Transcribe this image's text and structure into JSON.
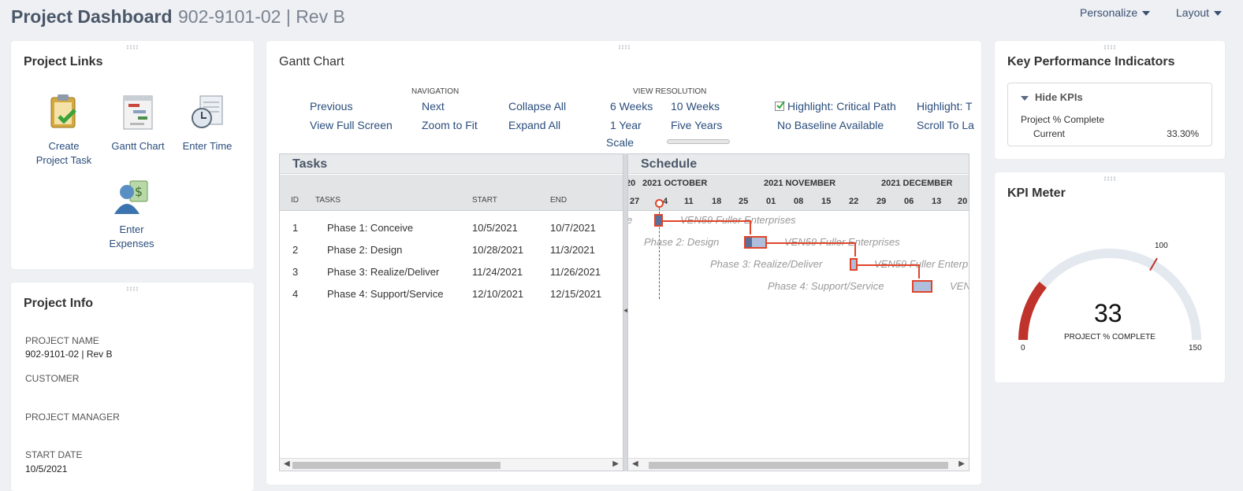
{
  "header": {
    "title": "Project Dashboard",
    "subtitle": "902-9101-02 | Rev B",
    "personalize": "Personalize",
    "layout": "Layout"
  },
  "project_links": {
    "title": "Project Links",
    "items": [
      {
        "label": "Create\nProject Task",
        "icon": "clipboard-check-icon"
      },
      {
        "label": "Gantt Chart",
        "icon": "gantt-chart-icon"
      },
      {
        "label": "Enter Time",
        "icon": "timesheet-clock-icon"
      },
      {
        "label": "Enter\nExpenses",
        "icon": "user-dollar-icon"
      }
    ]
  },
  "project_info": {
    "title": "Project Info",
    "fields": [
      {
        "label": "PROJECT NAME",
        "value": "902-9101-02 | Rev B"
      },
      {
        "label": "CUSTOMER",
        "value": ""
      },
      {
        "label": "PROJECT MANAGER",
        "value": ""
      },
      {
        "label": "START DATE",
        "value": "10/5/2021"
      }
    ]
  },
  "gantt": {
    "title": "Gantt Chart",
    "nav_header": "NAVIGATION",
    "view_header": "VIEW RESOLUTION",
    "previous": "Previous",
    "next": "Next",
    "collapse_all": "Collapse All",
    "view_full_screen": "View Full Screen",
    "zoom_to_fit": "Zoom to Fit",
    "expand_all": "Expand All",
    "six_weeks": "6 Weeks",
    "ten_weeks": "10 Weeks",
    "one_year": "1 Year",
    "five_years": "Five Years",
    "scale": "Scale",
    "highlight_critical": "Highlight: Critical Path",
    "highlight_other": "Highlight: T",
    "no_baseline": "No Baseline Available",
    "scroll_to": "Scroll To La",
    "tasks_title": "Tasks",
    "schedule_title": "Schedule",
    "columns": {
      "id": "ID",
      "tasks": "TASKS",
      "start": "START",
      "end": "END"
    },
    "rows": [
      {
        "id": "1",
        "task": "Phase 1: Conceive",
        "start": "10/5/2021",
        "end": "10/7/2021"
      },
      {
        "id": "2",
        "task": "Phase 2: Design",
        "start": "10/28/2021",
        "end": "11/3/2021"
      },
      {
        "id": "3",
        "task": "Phase 3: Realize/Deliver",
        "start": "11/24/2021",
        "end": "11/26/2021"
      },
      {
        "id": "4",
        "task": "Phase 4: Support/Service",
        "start": "12/10/2021",
        "end": "12/15/2021"
      }
    ],
    "months": {
      "oct_pre": "20",
      "oct": "2021 OCTOBER",
      "nov": "2021 NOVEMBER",
      "dec": "2021 DECEMBER"
    },
    "days": [
      "27",
      "4",
      "11",
      "18",
      "25",
      "01",
      "08",
      "15",
      "22",
      "29",
      "06",
      "13",
      "20"
    ],
    "bar_labels": {
      "clip_left": "e",
      "p1_resource": "VEN59 Fuller Enterprises",
      "p2_name": "Phase 2: Design",
      "p2_resource": "VEN59 Fuller Enterprises",
      "p3_name": "Phase 3: Realize/Deliver",
      "p3_resource": "VEN59 Fuller Enterp",
      "p4_name": "Phase 4: Support/Service",
      "p4_resource": "VEN"
    }
  },
  "kpi": {
    "title": "Key Performance Indicators",
    "toggle": "Hide KPIs",
    "metric": "Project % Complete",
    "current_label": "Current",
    "current_value": "33.30%"
  },
  "kpi_meter": {
    "title": "KPI Meter",
    "value": "33",
    "caption": "PROJECT % COMPLETE",
    "min": "0",
    "max": "150",
    "target": "100",
    "fraction": 0.22
  },
  "colors": {
    "accent_link": "#2a4d7c",
    "critical_path": "#e0442a",
    "meter_fill": "#c0332c",
    "meter_track": "#e4e8ef"
  }
}
